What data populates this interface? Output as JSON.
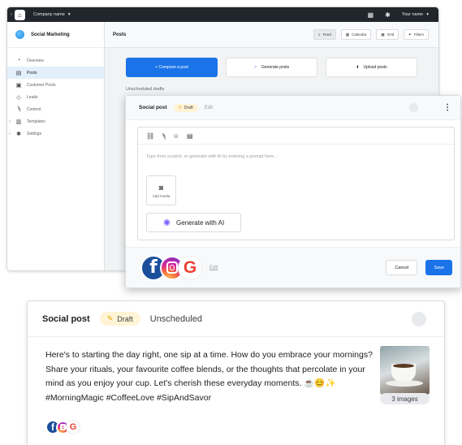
{
  "topbar": {
    "company_label": "Company name",
    "company_caret": "▾",
    "user_label": "Your name",
    "user_caret": "▾"
  },
  "sidebar": {
    "brand": "Social Marketing",
    "items": [
      {
        "label": "Overview",
        "icon": "speedometer-icon"
      },
      {
        "label": "Posts",
        "icon": "chat-icon"
      },
      {
        "label": "Customer Posts",
        "icon": "customer-posts-icon"
      },
      {
        "label": "Leads",
        "icon": "leads-icon"
      },
      {
        "label": "Content",
        "icon": "rss-icon"
      },
      {
        "label": "Templates",
        "icon": "template-icon"
      },
      {
        "label": "Settings",
        "icon": "gear-icon"
      }
    ]
  },
  "main": {
    "title": "Posts",
    "views": [
      {
        "label": "Feed",
        "icon": "feed-icon"
      },
      {
        "label": "Calendar",
        "icon": "calendar-icon"
      },
      {
        "label": "Grid",
        "icon": "grid-icon"
      },
      {
        "label": "Filters",
        "icon": "filter-icon"
      }
    ],
    "actions": {
      "compose": "+ Compose a post",
      "generate": "Generate posts",
      "upload": "Upload posts"
    },
    "section_label": "Unscheduled drafts"
  },
  "compose": {
    "title": "Social post",
    "status": "Draft",
    "edit_label": "Edit",
    "more": "⋮",
    "placeholder": "Type from scratch, or generate with AI by entering a prompt here...",
    "add_media": "Add media",
    "generate_ai": "Generate with AI",
    "footer_edit": "Edit",
    "cancel": "Cancel",
    "save": "Save"
  },
  "preview": {
    "title": "Social post",
    "status": "Draft",
    "schedule": "Unscheduled",
    "body": "Here's to starting the day right, one sip at a time. How do you embrace your mornings? Share your rituals, your favourite coffee blends, or the thoughts that percolate in your mind as you enjoy your cup. Let's cherish these everyday moments. ☕😊✨ #MorningMagic #CoffeeLove #SipAndSavor",
    "images_count": "3 images"
  },
  "colors": {
    "primary": "#1a73e8",
    "topbar": "#20262c",
    "draft_pill": "#fff4d6",
    "facebook": "#1b4f9c",
    "google_red": "#ea4335"
  }
}
